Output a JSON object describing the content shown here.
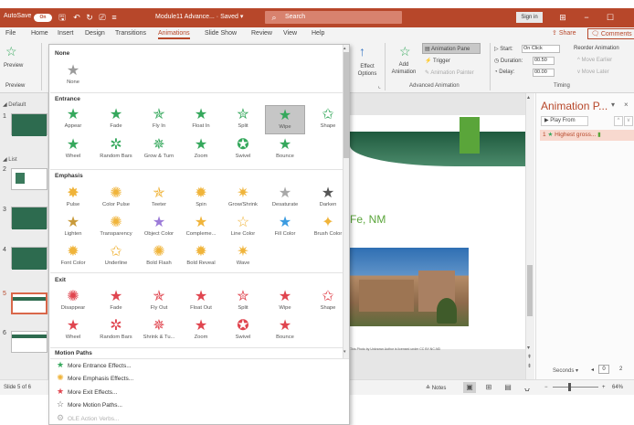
{
  "title_bar": {
    "autosave_label": "AutoSave",
    "autosave_state": "On",
    "doc_title": "Module11 Advance... · Saved ▾",
    "search_placeholder": "Search",
    "sign_in": "Sign in",
    "accent": "#b7472a"
  },
  "menu": {
    "tabs": [
      "File",
      "Home",
      "Insert",
      "Design",
      "Transitions",
      "Animations",
      "Slide Show",
      "Review",
      "View",
      "Help"
    ],
    "active_tab": "Animations",
    "share": "Share",
    "comments": "Comments"
  },
  "ribbon": {
    "preview": "Preview",
    "preview_group": "Preview",
    "effect_options": "Effect Options",
    "add_animation": "Add Animation",
    "animation_pane": "Animation Pane",
    "trigger": "Trigger",
    "animation_painter": "Animation Painter",
    "advanced_group": "Advanced Animation",
    "start_label": "Start:",
    "start_value": "On Click",
    "duration_label": "Duration:",
    "duration_value": "00.50",
    "delay_label": "Delay:",
    "delay_value": "00.00",
    "reorder": "Reorder Animation",
    "move_earlier": "Move Earlier",
    "move_later": "Move Later",
    "timing_group": "Timing"
  },
  "thumbnails": {
    "section_default": "Default",
    "section_list": "List",
    "slide_numbers": [
      "1",
      "2",
      "3",
      "4",
      "5",
      "6"
    ]
  },
  "gallery": {
    "none_header": "None",
    "none_item": "None",
    "entrance_header": "Entrance",
    "entrance": [
      "Appear",
      "Fade",
      "Fly In",
      "Float In",
      "Split",
      "Wipe",
      "Shape",
      "Wheel",
      "Random Bars",
      "Grow & Turn",
      "Zoom",
      "Swivel",
      "Bounce"
    ],
    "emphasis_header": "Emphasis",
    "emphasis": [
      "Pulse",
      "Color Pulse",
      "Teeter",
      "Spin",
      "Grow/Shrink",
      "Desaturate",
      "Darken",
      "Lighten",
      "Transparency",
      "Object Color",
      "Compleme...",
      "Line Color",
      "Fill Color",
      "Brush Color",
      "Font Color",
      "Underline",
      "Bold Flash",
      "Bold Reveal",
      "Wave"
    ],
    "exit_header": "Exit",
    "exit": [
      "Disappear",
      "Fade",
      "Fly Out",
      "Float Out",
      "Split",
      "Wipe",
      "Shape",
      "Wheel",
      "Random Bars",
      "Shrink & Tu...",
      "Zoom",
      "Swivel",
      "Bounce"
    ],
    "motion_header": "Motion Paths",
    "more": [
      "More Entrance Effects...",
      "More Emphasis Effects...",
      "More Exit Effects...",
      "More Motion Paths...",
      "OLE Action Verbs..."
    ],
    "selected": "Wipe",
    "colors": {
      "entrance": "#35a85c",
      "emphasis": "#f0b43a",
      "exit": "#e0454f"
    }
  },
  "slide": {
    "title_fragment": "Fe, NM",
    "caption": "This Photo by Unknown Author is licensed under CC BY-NC-ND"
  },
  "animation_pane": {
    "title": "Animation P...",
    "play_from": "Play From",
    "item_number": "1",
    "item_label": "Highest gross...",
    "seconds": "Seconds ▾",
    "timeline_0": "0",
    "timeline_2": "2"
  },
  "status": {
    "slide_of": "Slide 5 of 6",
    "notes": "Notes",
    "zoom": "64%"
  }
}
